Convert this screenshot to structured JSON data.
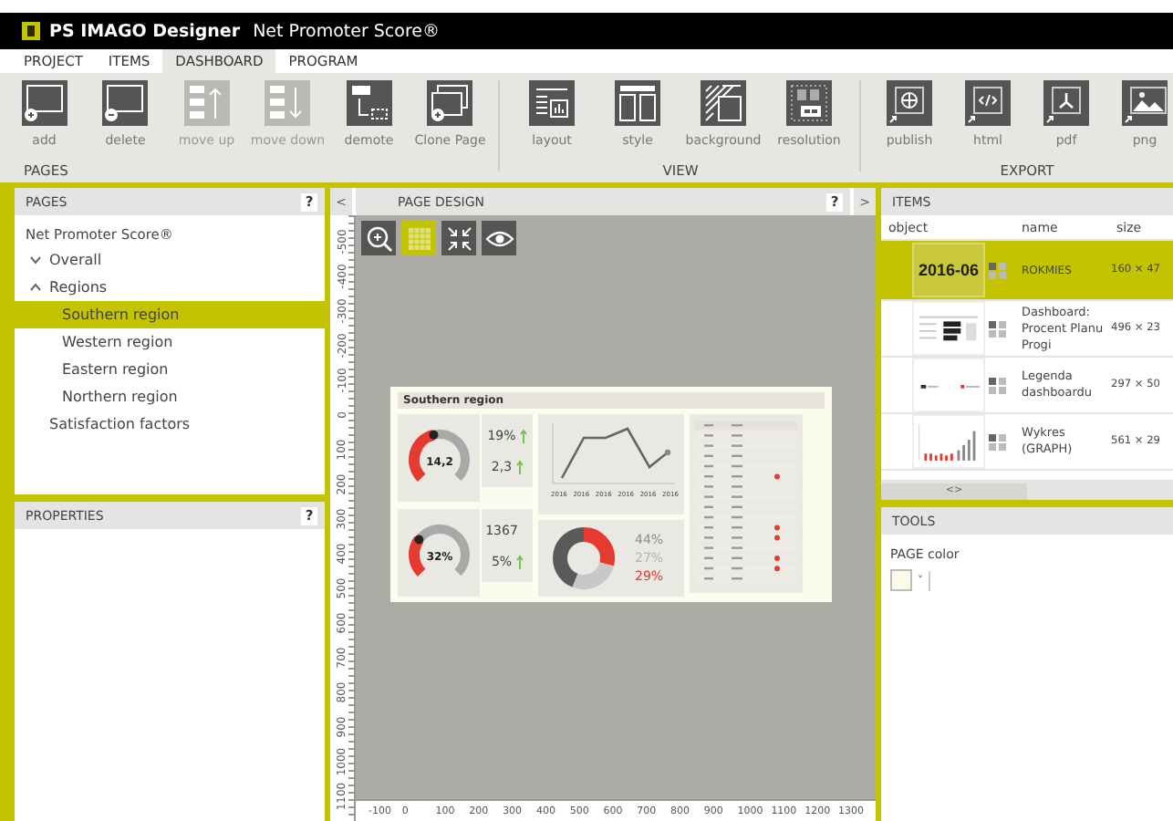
{
  "window": {
    "app_name": "PS IMAGO Designer",
    "document": "Net Promoter Score®"
  },
  "menu_tabs": [
    {
      "label": "PROJECT",
      "selected": false
    },
    {
      "label": "ITEMS",
      "selected": false
    },
    {
      "label": "DASHBOARD",
      "selected": true
    },
    {
      "label": "PROGRAM",
      "selected": false
    }
  ],
  "ribbon": [
    {
      "label": "PAGES",
      "buttons": [
        {
          "label": "add",
          "disabled": false
        },
        {
          "label": "delete",
          "disabled": false
        },
        {
          "label": "move up",
          "disabled": true
        },
        {
          "label": "move down",
          "disabled": true
        },
        {
          "label": "demote",
          "disabled": false
        },
        {
          "label": "Clone Page",
          "disabled": false
        }
      ]
    },
    {
      "label": "VIEW",
      "buttons": [
        {
          "label": "layout",
          "disabled": false
        },
        {
          "label": "style",
          "disabled": false
        },
        {
          "label": "background",
          "disabled": false
        },
        {
          "label": "resolution",
          "disabled": false
        }
      ]
    },
    {
      "label": "EXPORT",
      "buttons": [
        {
          "label": "publish",
          "disabled": false
        },
        {
          "label": "html",
          "disabled": false
        },
        {
          "label": "pdf",
          "disabled": false
        },
        {
          "label": "png",
          "disabled": false
        }
      ]
    }
  ],
  "pages_panel": {
    "title": "PAGES",
    "help": "?",
    "document_label": "Net Promoter Score®",
    "tree": [
      {
        "label": "Overall",
        "expanded": false,
        "selected": false
      },
      {
        "label": "Regions",
        "expanded": true,
        "selected": false,
        "children": [
          {
            "label": "Southern region",
            "selected": true
          },
          {
            "label": "Western region",
            "selected": false
          },
          {
            "label": "Eastern region",
            "selected": false
          },
          {
            "label": "Northern region",
            "selected": false
          }
        ]
      },
      {
        "label": "Satisfaction factors",
        "selected": false
      }
    ]
  },
  "properties_panel": {
    "title": "PROPERTIES",
    "help": "?"
  },
  "design_panel": {
    "title": "PAGE DESIGN",
    "help": "?",
    "prev": "<",
    "next": ">",
    "tools": [
      {
        "selected": false
      },
      {
        "selected": true
      },
      {
        "selected": false
      },
      {
        "selected": false
      }
    ],
    "ruler_v": [
      "-500",
      "-400",
      "-300",
      "-200",
      "-100",
      "0",
      "100",
      "200",
      "300",
      "400",
      "500",
      "600",
      "700",
      "800",
      "900",
      "1000",
      "1100"
    ],
    "ruler_h": [
      "-100",
      "0",
      "100",
      "200",
      "300",
      "400",
      "500",
      "600",
      "700",
      "800",
      "900",
      "1000",
      "1100",
      "1200",
      "1300"
    ],
    "page": {
      "title": "Southern region",
      "gauge_rows": [
        {
          "gauge": {
            "value": "14,2"
          },
          "kpis": [
            {
              "value": "19%",
              "arrow": true
            },
            {
              "value": "2,3",
              "arrow": true
            }
          ]
        },
        {
          "gauge": {
            "value": "32%"
          },
          "kpis": [
            {
              "value": "1367",
              "arrow": false
            },
            {
              "value": "5%",
              "arrow": true
            }
          ]
        }
      ],
      "line_chart": {
        "x_labels": [
          "2016",
          "2016",
          "2016",
          "2016",
          "2016",
          "2016"
        ]
      },
      "donut": [
        {
          "text": "44%",
          "color": "#8a8a8a"
        },
        {
          "text": "27%",
          "color": "#b5b5b5"
        },
        {
          "text": "29%",
          "color": "#e53a2f"
        }
      ]
    }
  },
  "items_panel": {
    "title": "ITEMS",
    "columns": [
      "object",
      "name",
      "size"
    ],
    "rows": [
      {
        "kind": "text",
        "thumb_text": "2016-06",
        "name": "ROKMIES",
        "size": "160 × 47",
        "selected": true
      },
      {
        "kind": "table",
        "name": "Dashboard: Procent Planu Progi",
        "size": "496 × 23",
        "selected": false
      },
      {
        "kind": "legend",
        "name": "Legenda dashboardu",
        "size": "297 × 50",
        "selected": false
      },
      {
        "kind": "bars",
        "name": "Wykres (GRAPH)",
        "size": "561 × 29",
        "selected": false
      }
    ],
    "scroll_label": "<>"
  },
  "tools_panel": {
    "title": "TOOLS",
    "fields": [
      {
        "label": "PAGE color",
        "color": "#fdfbe8",
        "dropdown": "˅"
      }
    ]
  }
}
